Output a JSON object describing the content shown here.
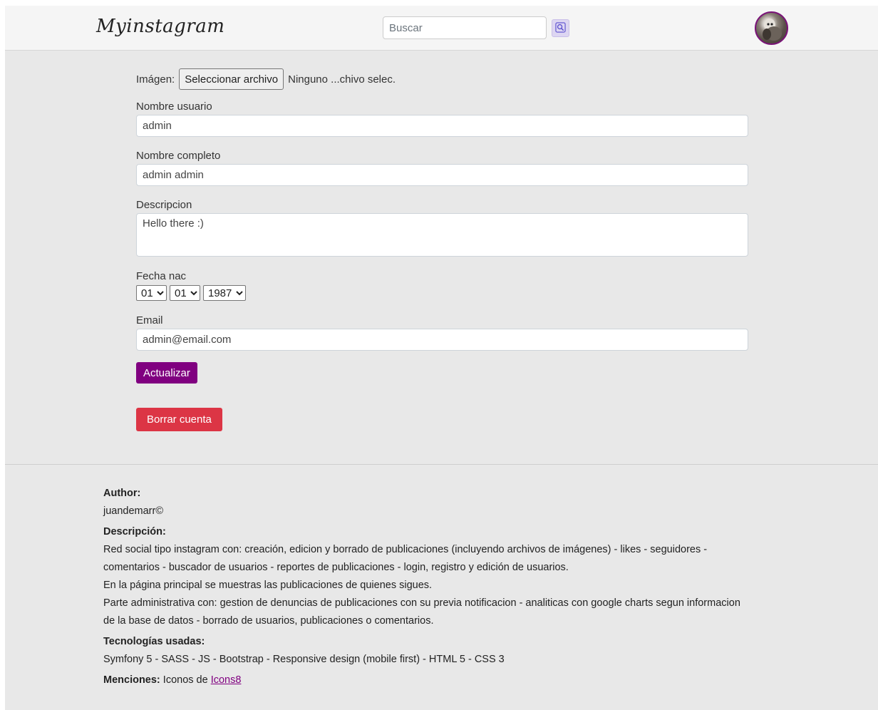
{
  "header": {
    "brand": "Myinstagram",
    "search_placeholder": "Buscar",
    "search_icon": "magnifier-icon",
    "avatar_icon": "user-avatar"
  },
  "form": {
    "image_label": "Imágen:",
    "file_button": "Seleccionar archivo",
    "file_status": "Ninguno ...chivo selec.",
    "username_label": "Nombre usuario",
    "username_value": "admin",
    "fullname_label": "Nombre completo",
    "fullname_value": "admin admin",
    "description_label": "Descripcion",
    "description_value": "Hello there :)",
    "birthdate_label": "Fecha nac",
    "birth_day": "01",
    "birth_month": "01",
    "birth_year": "1987",
    "email_label": "Email",
    "email_value": "admin@email.com",
    "update_button": "Actualizar",
    "delete_button": "Borrar cuenta"
  },
  "footer": {
    "author_heading": "Author:",
    "author_name": "juandemarr©",
    "description_heading": "Descripción:",
    "description_line1": "Red social tipo instagram con: creación, edicion y borrado de publicaciones (incluyendo archivos de imágenes) - likes - seguidores -",
    "description_line2": "comentarios - buscador de usuarios - reportes de publicaciones - login, registro y edición de usuarios.",
    "description_line3": "En la página principal se muestras las publicaciones de quienes sigues.",
    "description_line4": "Parte administrativa con: gestion de denuncias de publicaciones con su previa notificacion - analiticas con google charts segun informacion",
    "description_line5": "de la base de datos - borrado de usuarios, publicaciones o comentarios.",
    "tech_heading": "Tecnologías usadas:",
    "tech_text": "Symfony 5 - SASS - JS - Bootstrap - Responsive design (mobile first) - HTML 5 - CSS 3",
    "mentions_heading": "Menciones:",
    "mentions_text": "Iconos de",
    "mentions_link": "Icons8"
  },
  "colors": {
    "primary": "#800080",
    "danger": "#dc3545",
    "background": "#e8e8e8"
  }
}
